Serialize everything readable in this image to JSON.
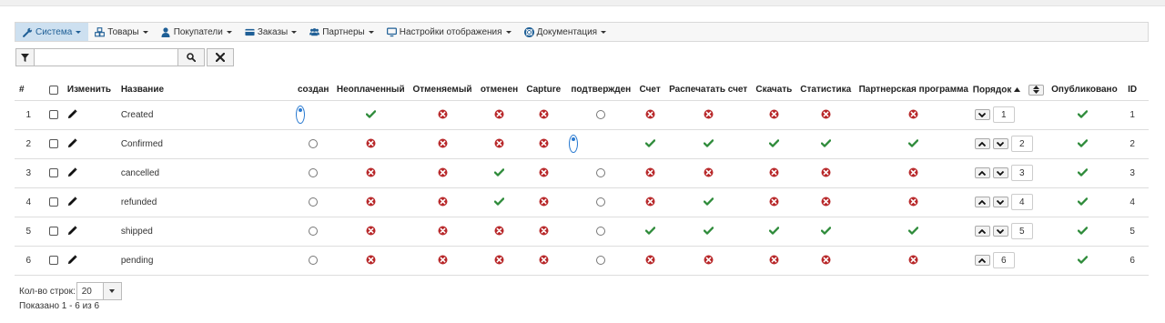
{
  "menu": [
    {
      "label": "Система",
      "icon": "wrench-icon",
      "active": true
    },
    {
      "label": "Товары",
      "icon": "cubes-icon",
      "active": false
    },
    {
      "label": "Покупатели",
      "icon": "user-icon",
      "active": false
    },
    {
      "label": "Заказы",
      "icon": "credit-card-icon",
      "active": false
    },
    {
      "label": "Партнеры",
      "icon": "users-icon",
      "active": false
    },
    {
      "label": "Настройки отображения",
      "icon": "monitor-icon",
      "active": false
    },
    {
      "label": "Документация",
      "icon": "help-icon",
      "active": false
    }
  ],
  "filter": {
    "placeholder": "",
    "value": ""
  },
  "table": {
    "headers": {
      "num": "#",
      "edit": "Изменить",
      "name": "Название",
      "created": "создан",
      "unpaid": "Неоплаченный",
      "cancellable": "Отменяемый",
      "cancelled": "отменен",
      "capture": "Capture",
      "confirmed": "подтвержден",
      "invoice": "Счет",
      "print_invoice": "Распечатать счет",
      "download": "Скачать",
      "stats": "Статистика",
      "affiliate": "Партнерская программа",
      "order": "Порядок",
      "published": "Опубликовано",
      "id": "ID"
    },
    "rows": [
      {
        "num": "1",
        "name": "Created",
        "created": true,
        "unpaid": "yes",
        "cancellable": "no",
        "cancelled": "no",
        "capture": "no",
        "confirmed": false,
        "invoice": "no",
        "print_invoice": "no",
        "download": "no",
        "stats": "no",
        "affiliate": "no",
        "order": "1",
        "up": false,
        "down": true,
        "published": "yes",
        "id": "1"
      },
      {
        "num": "2",
        "name": "Confirmed",
        "created": false,
        "unpaid": "no",
        "cancellable": "no",
        "cancelled": "no",
        "capture": "no",
        "confirmed": true,
        "invoice": "yes",
        "print_invoice": "yes",
        "download": "yes",
        "stats": "yes",
        "affiliate": "yes",
        "order": "2",
        "up": true,
        "down": true,
        "published": "yes",
        "id": "2"
      },
      {
        "num": "3",
        "name": "cancelled",
        "created": false,
        "unpaid": "no",
        "cancellable": "no",
        "cancelled": "yes",
        "capture": "no",
        "confirmed": false,
        "invoice": "no",
        "print_invoice": "no",
        "download": "no",
        "stats": "no",
        "affiliate": "no",
        "order": "3",
        "up": true,
        "down": true,
        "published": "yes",
        "id": "3"
      },
      {
        "num": "4",
        "name": "refunded",
        "created": false,
        "unpaid": "no",
        "cancellable": "no",
        "cancelled": "yes",
        "capture": "no",
        "confirmed": false,
        "invoice": "no",
        "print_invoice": "yes",
        "download": "no",
        "stats": "no",
        "affiliate": "no",
        "order": "4",
        "up": true,
        "down": true,
        "published": "yes",
        "id": "4"
      },
      {
        "num": "5",
        "name": "shipped",
        "created": false,
        "unpaid": "no",
        "cancellable": "no",
        "cancelled": "no",
        "capture": "no",
        "confirmed": false,
        "invoice": "yes",
        "print_invoice": "yes",
        "download": "yes",
        "stats": "yes",
        "affiliate": "yes",
        "order": "5",
        "up": true,
        "down": true,
        "published": "yes",
        "id": "5"
      },
      {
        "num": "6",
        "name": "pending",
        "created": false,
        "unpaid": "no",
        "cancellable": "no",
        "cancelled": "no",
        "capture": "no",
        "confirmed": false,
        "invoice": "no",
        "print_invoice": "no",
        "download": "no",
        "stats": "no",
        "affiliate": "no",
        "order": "6",
        "up": true,
        "down": false,
        "published": "yes",
        "id": "6"
      }
    ]
  },
  "footer": {
    "rows_label": "Кол-во строк:",
    "rows_value": "20",
    "shown": "Показано 1 - 6 из 6"
  },
  "colors": {
    "check": "#2e8b3a",
    "cross": "#b8282a",
    "accent": "#1f5f96"
  }
}
